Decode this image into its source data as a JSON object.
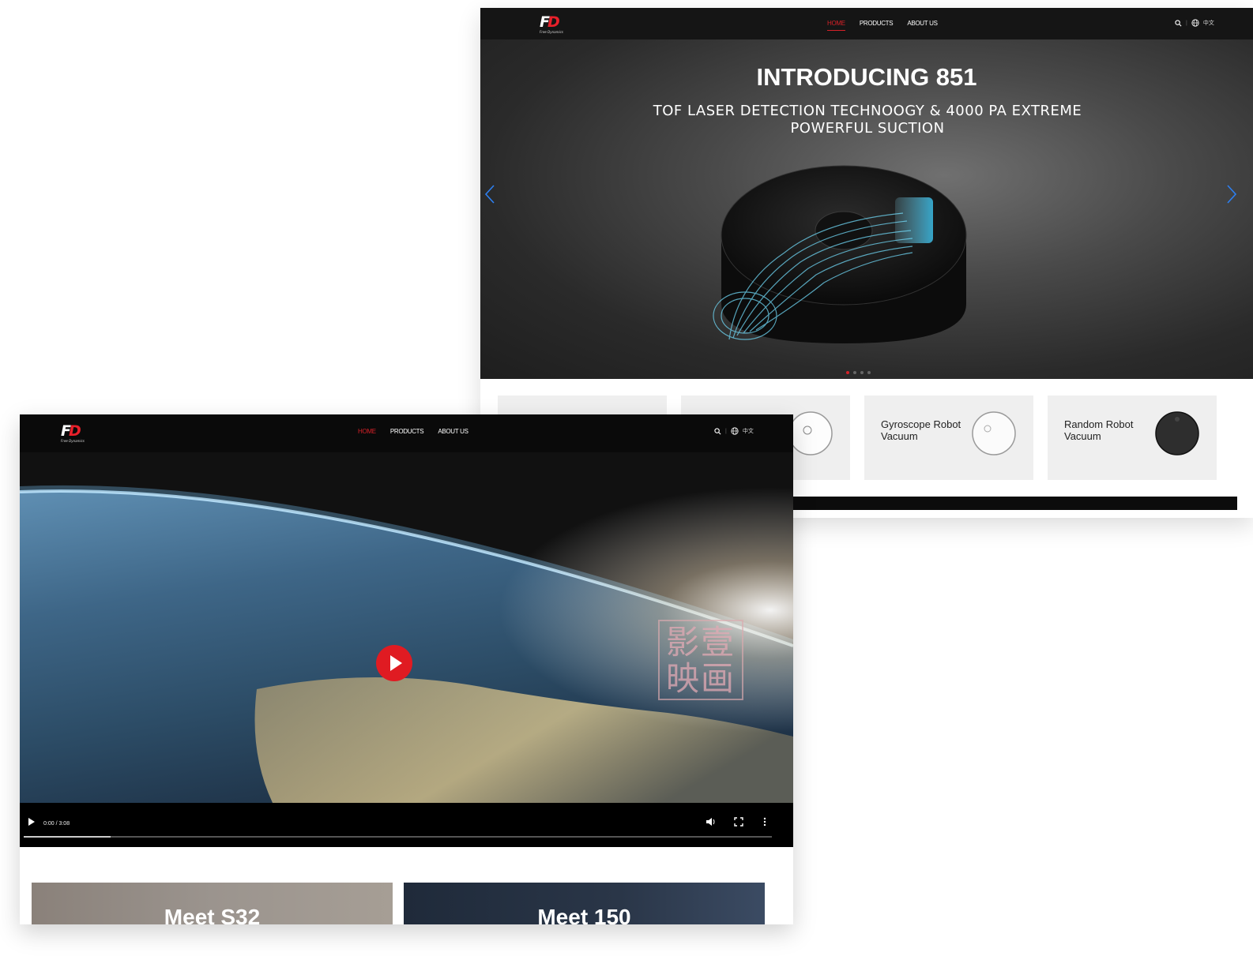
{
  "brand": {
    "logo_f": "F",
    "logo_d": "D",
    "logo_small": "Free Dynamics"
  },
  "nav": {
    "home": "HOME",
    "products": "PRODUCTS",
    "about": "ABOUT US",
    "language": "中文"
  },
  "hero": {
    "title": "INTRODUCING 851",
    "subtitle": "TOF LASER DETECTION TECHNOOGY & 4000 PA EXTREME POWERFUL SUCTION",
    "dots": 4,
    "active_dot": 1
  },
  "product_cards": [
    {
      "title": ""
    },
    {
      "title": ""
    },
    {
      "title": "Gyroscope Robot Vacuum"
    },
    {
      "title": "Random Robot Vacuum"
    }
  ],
  "video": {
    "time": "0:00 / 3:08",
    "progress": 0.116,
    "watermark": "影壹映画"
  },
  "tiles": [
    {
      "title": "Meet S32"
    },
    {
      "title": "Meet 150"
    }
  ],
  "colors": {
    "accent": "#d62128",
    "nav_bg": "#151515",
    "card_bg": "#efefef",
    "play_red": "#e01b22",
    "arrow_blue": "#2d7ff0"
  },
  "icons": [
    "search-icon",
    "globe-icon",
    "chevron-left-icon",
    "chevron-right-icon",
    "play-icon",
    "volume-icon",
    "fullscreen-icon",
    "more-vertical-icon"
  ]
}
